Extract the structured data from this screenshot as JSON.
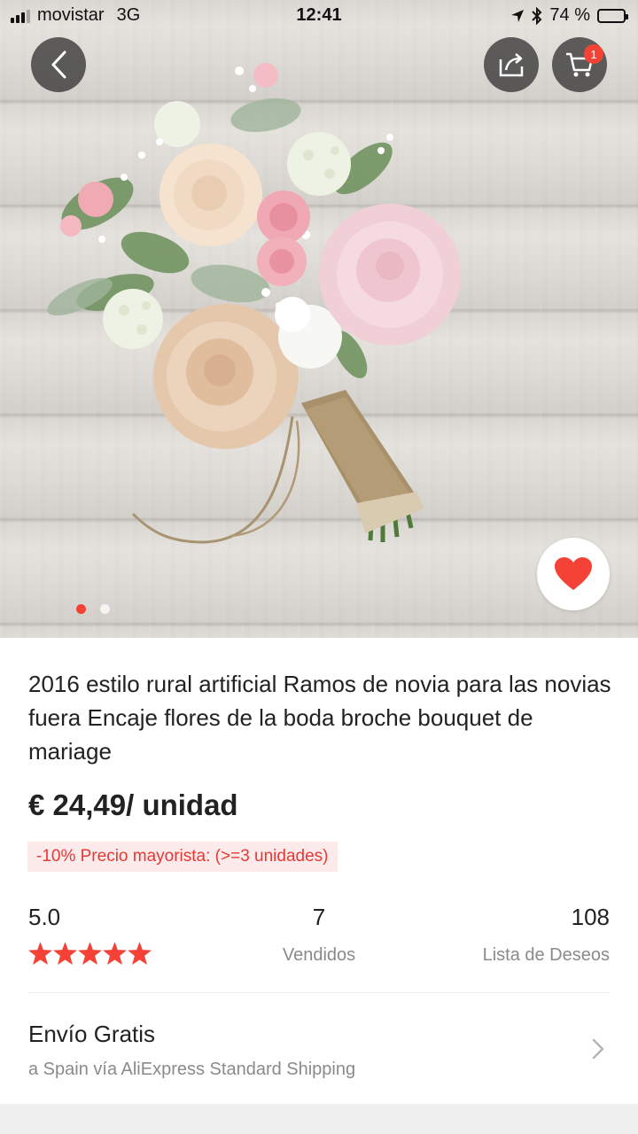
{
  "status_bar": {
    "carrier": "movistar",
    "network": "3G",
    "time": "12:41",
    "battery": "74 %"
  },
  "header": {
    "back_icon": "chevron-left-icon",
    "share_icon": "share-icon",
    "cart_icon": "cart-icon",
    "cart_count": "1"
  },
  "gallery": {
    "image": "bridal bouquet photo",
    "favorite_icon": "heart-icon",
    "page_count": 2,
    "active_page": 1
  },
  "product": {
    "title": "2016 estilo rural artificial Ramos de novia para las novias fuera Encaje flores de la boda broche bouquet de mariage",
    "price": "€ 24,49/ unidad",
    "discount": "-10% Precio mayorista: (>=3 unidades)"
  },
  "stats": {
    "rating": "5.0",
    "rating_stars": 5,
    "sold_count": "7",
    "sold_label": "Vendidos",
    "wishlist_count": "108",
    "wishlist_label": "Lista de Deseos"
  },
  "shipping": {
    "title": "Envío Gratis",
    "subtitle": "a Spain vía AliExpress Standard Shipping"
  },
  "colors": {
    "accent": "#f44336",
    "discount_bg": "#fdeaea",
    "muted_text": "#8a8a8a"
  }
}
